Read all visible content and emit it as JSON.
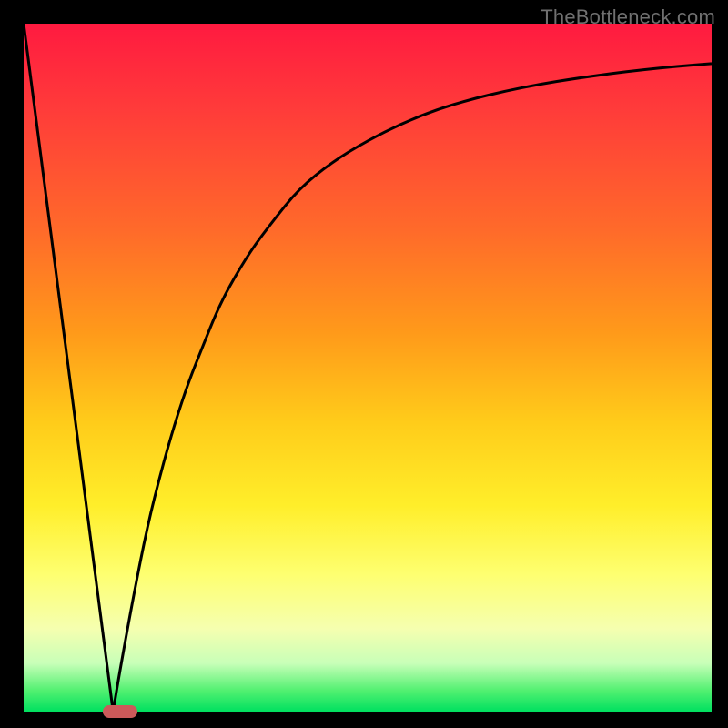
{
  "watermark": "TheBottleneck.com",
  "chart_data": {
    "type": "line",
    "title": "",
    "xlabel": "",
    "ylabel": "",
    "xlim": [
      0,
      100
    ],
    "ylim": [
      0,
      100
    ],
    "grid": false,
    "legend": false,
    "x": [
      0,
      2,
      4,
      6,
      8,
      10,
      12,
      13,
      14,
      16,
      18,
      20,
      22,
      24,
      26,
      28,
      30,
      33,
      36,
      40,
      45,
      50,
      55,
      60,
      65,
      70,
      75,
      80,
      85,
      90,
      95,
      100
    ],
    "series": [
      {
        "name": "left-line",
        "x": [
          0,
          13
        ],
        "y": [
          100,
          0
        ]
      },
      {
        "name": "right-curve",
        "x": [
          13,
          14,
          16,
          18,
          20,
          22,
          24,
          26,
          28,
          30,
          33,
          36,
          40,
          45,
          50,
          55,
          60,
          65,
          70,
          75,
          80,
          85,
          90,
          95,
          100
        ],
        "y": [
          0,
          6,
          17,
          27,
          35,
          42,
          48,
          53,
          58,
          62,
          67,
          71,
          76,
          80,
          83,
          85.5,
          87.5,
          89,
          90.2,
          91.2,
          92,
          92.7,
          93.3,
          93.8,
          94.2
        ]
      }
    ],
    "marker": {
      "x": 14,
      "y": 0,
      "color": "#cc5a5a",
      "shape": "pill"
    },
    "gradient_stops": [
      {
        "pos": 0,
        "color": "#ff1a40"
      },
      {
        "pos": 30,
        "color": "#ff6a2a"
      },
      {
        "pos": 58,
        "color": "#ffcc1a"
      },
      {
        "pos": 80,
        "color": "#feff70"
      },
      {
        "pos": 97,
        "color": "#50f070"
      },
      {
        "pos": 100,
        "color": "#00e060"
      }
    ]
  }
}
